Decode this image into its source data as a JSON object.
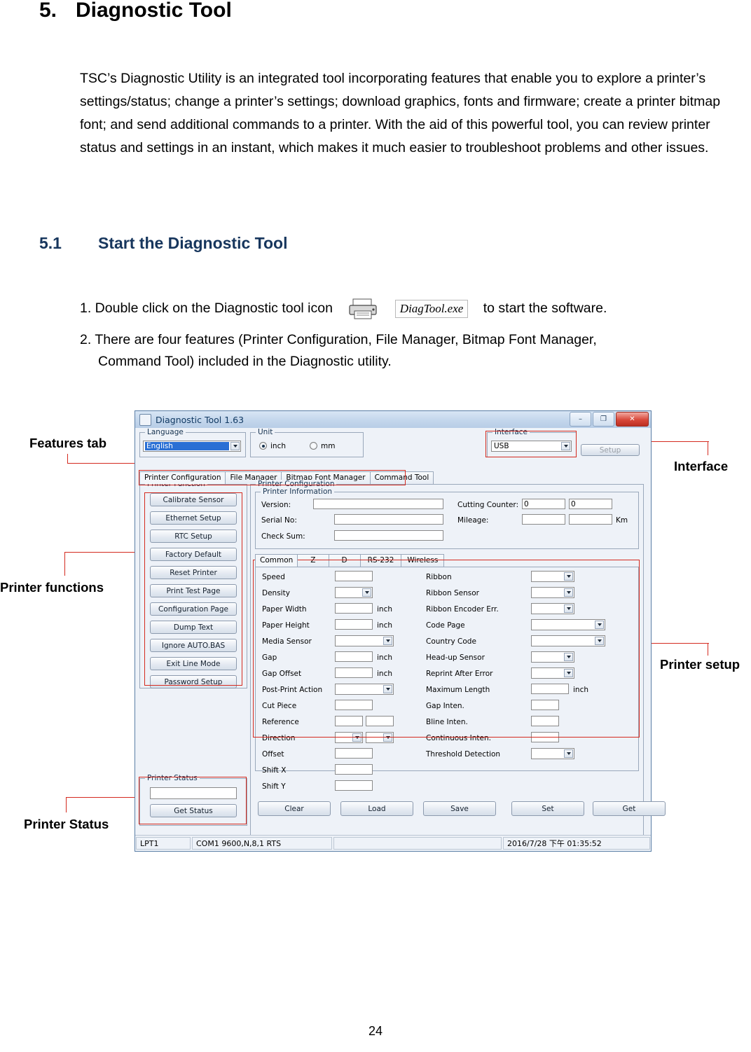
{
  "document": {
    "heading_number": "5.",
    "heading_title": "Diagnostic Tool",
    "paragraph": "TSC’s Diagnostic Utility is an integrated tool incorporating features that enable you to explore a printer’s settings/status; change a printer’s settings; download graphics, fonts and firmware; create a printer bitmap font; and send additional commands to a printer. With the aid of this powerful tool, you can review printer status and settings in an instant, which makes it much easier to troubleshoot problems and other issues.",
    "sub_heading_number": "5.1",
    "sub_heading_title": "Start the Diagnostic Tool",
    "step1_lead": "1. Double click on the Diagnostic tool icon",
    "step1_icon_label": "DiagTool.exe",
    "step1_tail": "to start the software.",
    "step2_line1": "2. There are four features (Printer Configuration, File Manager, Bitmap Font Manager,",
    "step2_line2": "Command Tool) included in the Diagnostic utility.",
    "page_number": "24"
  },
  "callouts": {
    "features_tab": "Features tab",
    "interface": "Interface",
    "printer_functions": "Printer functions",
    "printer_setup": "Printer setup",
    "printer_status": "Printer Status",
    "accent_color": "#d42a1f"
  },
  "app": {
    "title": "Diagnostic Tool 1.63",
    "window_buttons": {
      "minimize": "–",
      "maximize": "❐",
      "close": "✕"
    },
    "language": {
      "group": "Language",
      "value": "English"
    },
    "unit": {
      "group": "Unit",
      "inch": "inch",
      "mm": "mm",
      "selected": "inch"
    },
    "interface": {
      "group": "Interface",
      "value": "USB",
      "setup_button": "Setup"
    },
    "feature_tabs": [
      {
        "label": "Printer Configuration",
        "active": true
      },
      {
        "label": "File Manager",
        "active": false
      },
      {
        "label": "Bitmap Font Manager",
        "active": false
      },
      {
        "label": "Command Tool",
        "active": false
      }
    ],
    "printer_function": {
      "group": "Printer Function",
      "buttons": [
        "Calibrate Sensor",
        "Ethernet Setup",
        "RTC Setup",
        "Factory Default",
        "Reset Printer",
        "Print Test Page",
        "Configuration Page",
        "Dump Text",
        "Ignore AUTO.BAS",
        "Exit Line Mode",
        "Password Setup"
      ]
    },
    "printer_status": {
      "group": "Printer Status",
      "value": "",
      "button": "Get Status"
    },
    "printer_configuration": {
      "group": "Printer Configuration",
      "information": {
        "group": "Printer Information",
        "version_label": "Version:",
        "version_value": "",
        "serial_label": "Serial No:",
        "serial_value": "",
        "checksum_label": "Check Sum:",
        "checksum_value": "",
        "cutting_counter_label": "Cutting Counter:",
        "cutting_counter_value": "0",
        "cutting_counter_value2": "0",
        "mileage_label": "Mileage:",
        "mileage_value": "",
        "mileage_value2": "",
        "mileage_unit": "Km"
      },
      "tabs": [
        {
          "label": "Common",
          "active": true
        },
        {
          "label": "Z",
          "active": false
        },
        {
          "label": "D",
          "active": false
        },
        {
          "label": "RS-232",
          "active": false
        },
        {
          "label": "Wireless",
          "active": false
        }
      ],
      "left_fields": [
        {
          "label": "Speed",
          "type": "text",
          "value": ""
        },
        {
          "label": "Density",
          "type": "combo",
          "value": ""
        },
        {
          "label": "Paper Width",
          "type": "text",
          "value": "",
          "unit": "inch"
        },
        {
          "label": "Paper Height",
          "type": "text",
          "value": "",
          "unit": "inch"
        },
        {
          "label": "Media Sensor",
          "type": "combo-wide",
          "value": ""
        },
        {
          "label": "Gap",
          "type": "text",
          "value": "",
          "unit": "inch"
        },
        {
          "label": "Gap Offset",
          "type": "text",
          "value": "",
          "unit": "inch"
        },
        {
          "label": "Post-Print Action",
          "type": "combo-wide",
          "value": ""
        },
        {
          "label": "Cut Piece",
          "type": "text",
          "value": ""
        },
        {
          "label": "Reference",
          "type": "text2",
          "value": ""
        },
        {
          "label": "Direction",
          "type": "combo2",
          "value": ""
        },
        {
          "label": "Offset",
          "type": "text",
          "value": ""
        },
        {
          "label": "Shift X",
          "type": "text",
          "value": ""
        },
        {
          "label": "Shift Y",
          "type": "text",
          "value": ""
        }
      ],
      "right_fields": [
        {
          "label": "Ribbon",
          "type": "combo",
          "value": ""
        },
        {
          "label": "Ribbon Sensor",
          "type": "combo",
          "value": ""
        },
        {
          "label": "Ribbon Encoder Err.",
          "type": "combo",
          "value": ""
        },
        {
          "label": "Code Page",
          "type": "combo-wide",
          "value": ""
        },
        {
          "label": "Country Code",
          "type": "combo-wide",
          "value": ""
        },
        {
          "label": "Head-up Sensor",
          "type": "combo",
          "value": ""
        },
        {
          "label": "Reprint After Error",
          "type": "combo",
          "value": ""
        },
        {
          "label": "Maximum Length",
          "type": "text",
          "value": "",
          "unit": "inch"
        },
        {
          "label": "Gap Inten.",
          "type": "text",
          "value": ""
        },
        {
          "label": "Bline Inten.",
          "type": "text",
          "value": ""
        },
        {
          "label": "Continuous Inten.",
          "type": "text",
          "value": ""
        },
        {
          "label": "Threshold Detection",
          "type": "combo",
          "value": ""
        }
      ],
      "action_buttons": [
        "Clear",
        "Load",
        "Save",
        "Set",
        "Get"
      ]
    },
    "statusbar": {
      "port": "LPT1",
      "comport": "COM1 9600,N,8,1 RTS",
      "middle": "",
      "datetime": "2016/7/28 下午 01:35:52"
    }
  }
}
